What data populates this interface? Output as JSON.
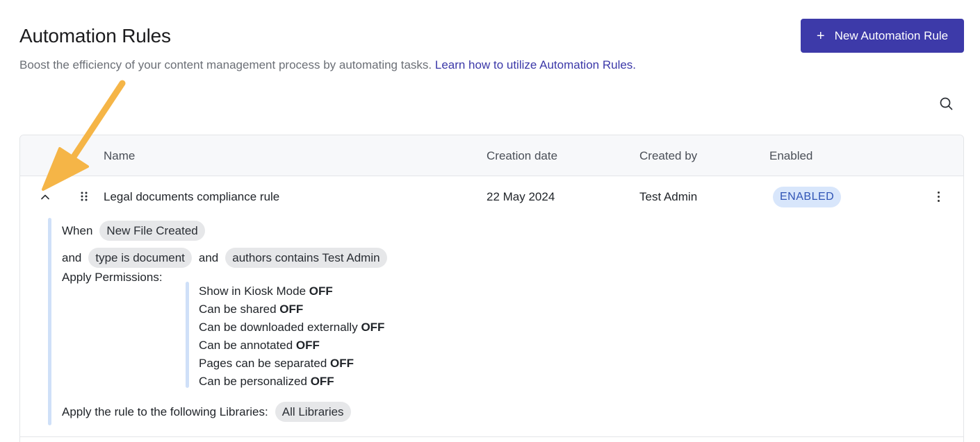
{
  "header": {
    "title": "Automation Rules",
    "subtitle": "Boost the efficiency of your content management process by automating tasks.",
    "learn_link": "Learn how to utilize Automation Rules.",
    "new_button_icon": "plus-icon",
    "new_button_label": "New Automation Rule",
    "accent_color": "#3d3aa9"
  },
  "toolbar": {
    "search_icon": "search-icon"
  },
  "table": {
    "columns": [
      "Name",
      "Creation date",
      "Created by",
      "Enabled"
    ],
    "rows": [
      {
        "name": "Legal documents compliance rule",
        "creation_date": "22 May 2024",
        "created_by": "Test Admin",
        "status": "ENABLED",
        "expanded": true,
        "detail": {
          "when_label": "When",
          "trigger": "New File Created",
          "and_label": "and",
          "conditions": [
            "type is document",
            "authors contains Test Admin"
          ],
          "permissions_label": "Apply Permissions:",
          "permissions": [
            {
              "label": "Show in Kiosk Mode",
              "value": "OFF"
            },
            {
              "label": "Can be shared",
              "value": "OFF"
            },
            {
              "label": "Can be downloaded externally",
              "value": "OFF"
            },
            {
              "label": "Can be annotated",
              "value": "OFF"
            },
            {
              "label": "Pages can be separated",
              "value": "OFF"
            },
            {
              "label": "Can be personalized",
              "value": "OFF"
            }
          ],
          "libraries_label": "Apply the rule to the following Libraries:",
          "libraries_value": "All Libraries"
        }
      }
    ]
  },
  "colors": {
    "badge_bg": "#d8e6fb",
    "badge_text": "#2f54b5",
    "annotation_arrow": "#f5b547"
  }
}
